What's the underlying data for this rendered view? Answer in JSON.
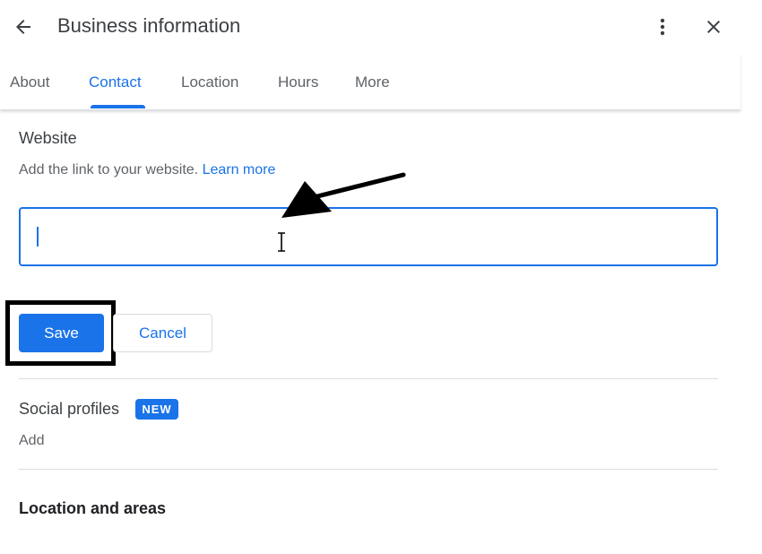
{
  "header": {
    "title": "Business information",
    "back_icon": "arrow-left-icon",
    "more_icon": "more-vert-icon",
    "close_icon": "close-icon"
  },
  "tabs": [
    {
      "label": "About",
      "active": false
    },
    {
      "label": "Contact",
      "active": true
    },
    {
      "label": "Location",
      "active": false
    },
    {
      "label": "Hours",
      "active": false
    },
    {
      "label": "More",
      "active": false
    }
  ],
  "website": {
    "title": "Website",
    "helper_text": "Add the link to your website.",
    "learn_more_label": "Learn more",
    "input_value": ""
  },
  "actions": {
    "save_label": "Save",
    "cancel_label": "Cancel"
  },
  "social": {
    "title": "Social profiles",
    "badge": "NEW",
    "add_label": "Add"
  },
  "location": {
    "title": "Location and areas"
  },
  "colors": {
    "accent": "#1a73e8",
    "text_primary": "#202124",
    "text_secondary": "#5f6368",
    "divider": "#dadce0"
  }
}
